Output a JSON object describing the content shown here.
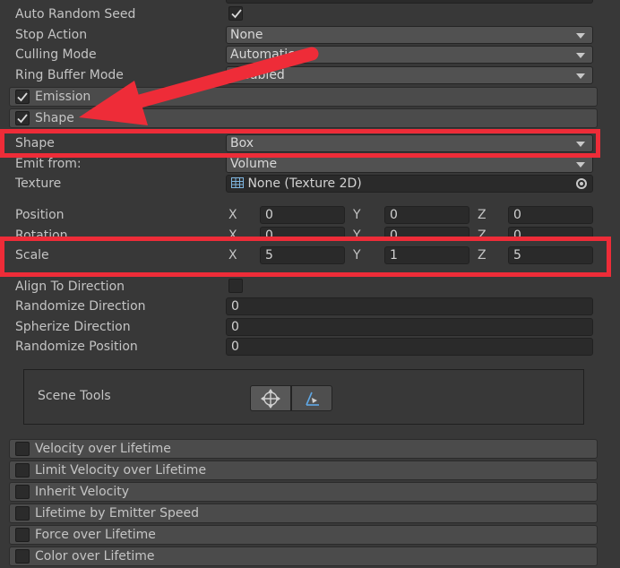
{
  "main_rows": {
    "auto_random_seed": {
      "label": "Auto Random Seed",
      "checked": true
    },
    "stop_action": {
      "label": "Stop Action",
      "value": "None"
    },
    "culling_mode": {
      "label": "Culling Mode",
      "value": "Automatic"
    },
    "ring_buffer_mode": {
      "label": "Ring Buffer Mode",
      "value": "Disabled"
    }
  },
  "modules": {
    "emission": {
      "label": "Emission",
      "enabled": true
    },
    "shape": {
      "label": "Shape",
      "enabled": true
    }
  },
  "shape_module": {
    "shape": {
      "label": "Shape",
      "value": "Box"
    },
    "emit_from": {
      "label": "Emit from:",
      "value": "Volume"
    },
    "texture": {
      "label": "Texture",
      "value": "None (Texture 2D)"
    },
    "position": {
      "label": "Position",
      "x": "0",
      "y": "0",
      "z": "0"
    },
    "rotation": {
      "label": "Rotation",
      "x": "0",
      "y": "0",
      "z": "0"
    },
    "scale": {
      "label": "Scale",
      "x": "5",
      "y": "1",
      "z": "5"
    },
    "axis_labels": {
      "x": "X",
      "y": "Y",
      "z": "Z"
    },
    "align_to_direction": {
      "label": "Align To Direction",
      "checked": false
    },
    "randomize_direction": {
      "label": "Randomize Direction",
      "value": "0"
    },
    "spherize_direction": {
      "label": "Spherize Direction",
      "value": "0"
    },
    "randomize_position": {
      "label": "Randomize Position",
      "value": "0"
    },
    "scene_tools": {
      "label": "Scene Tools",
      "tools": [
        "move-tool-icon",
        "edit-shape-icon"
      ]
    }
  },
  "disabled_modules": [
    {
      "label": "Velocity over Lifetime",
      "enabled": false
    },
    {
      "label": "Limit Velocity over Lifetime",
      "enabled": false
    },
    {
      "label": "Inherit Velocity",
      "enabled": false
    },
    {
      "label": "Lifetime by Emitter Speed",
      "enabled": false
    },
    {
      "label": "Force over Lifetime",
      "enabled": false
    },
    {
      "label": "Color over Lifetime",
      "enabled": false
    }
  ],
  "colors": {
    "background": "#383838",
    "highlight": "#ee2c38",
    "module_header": "#4b4b4b",
    "field": "#2a2a2a"
  }
}
